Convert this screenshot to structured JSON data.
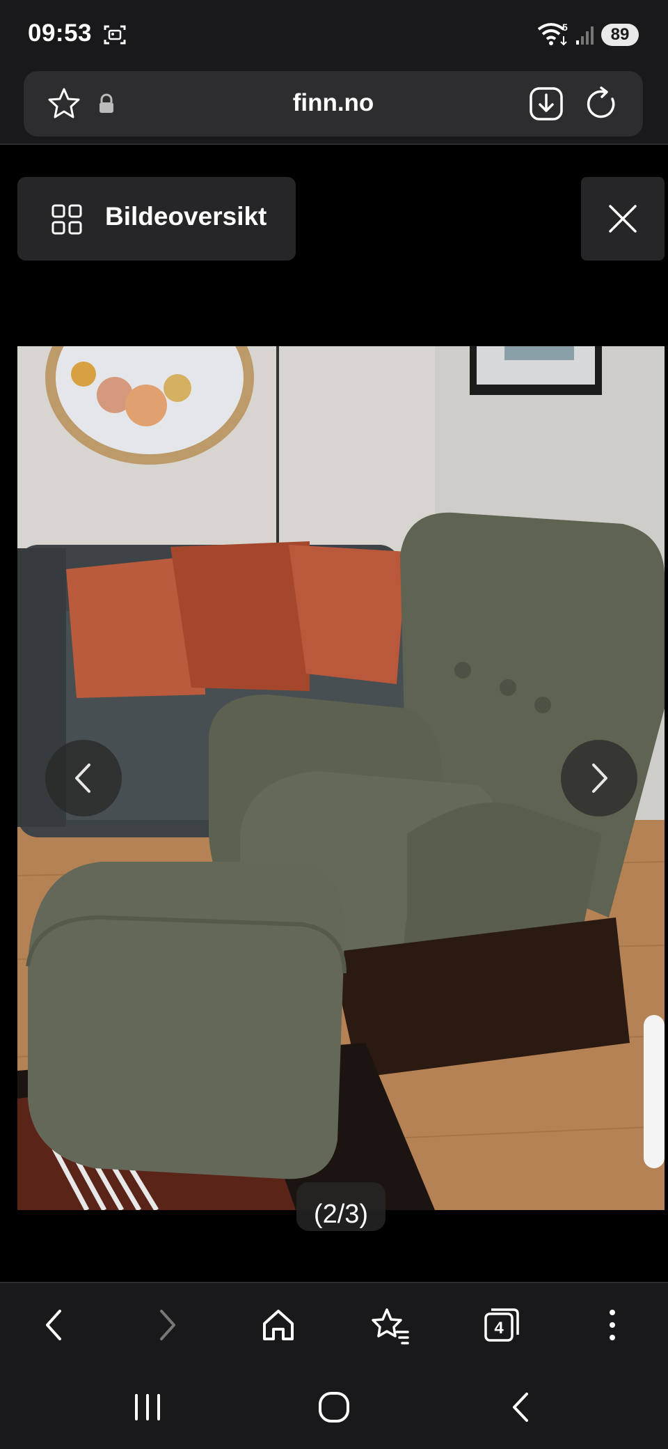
{
  "status_bar": {
    "time": "09:53",
    "wifi_badge": "5",
    "battery": "89"
  },
  "browser": {
    "domain": "finn.no",
    "tabs_count": "4"
  },
  "gallery": {
    "overview_label": "Bildeoversikt",
    "counter": "(2/3)"
  },
  "icons": {
    "status": [
      "screenshot-icon",
      "wifi-icon",
      "signal-icon"
    ],
    "url_bar": [
      "star-icon",
      "lock-icon",
      "download-icon",
      "reload-icon"
    ],
    "gallery": [
      "grid-icon",
      "close-icon",
      "chevron-left-icon",
      "chevron-right-icon"
    ],
    "toolbar": [
      "back-icon",
      "forward-icon",
      "home-icon",
      "bookmarks-icon",
      "tabs-icon",
      "more-icon"
    ],
    "system": [
      "recent-apps-icon",
      "home-circle-icon",
      "system-back-icon"
    ]
  },
  "colors": {
    "chrome_bg": "#19191b",
    "url_bar_bg": "#2d2d30",
    "button_bg": "#262628"
  }
}
